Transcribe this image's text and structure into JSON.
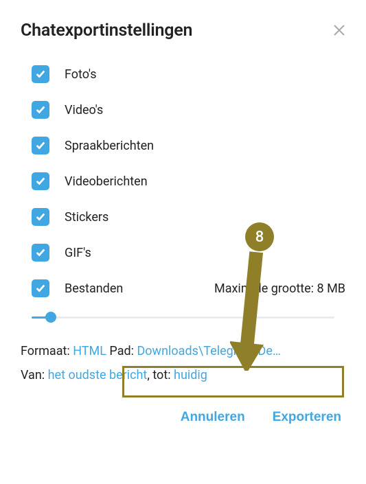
{
  "title": "Chatexportinstellingen",
  "options": {
    "photos": "Foto's",
    "videos": "Video's",
    "voice": "Spraakberichten",
    "videomsg": "Videoberichten",
    "stickers": "Stickers",
    "gifs": "GIF's",
    "files": "Bestanden"
  },
  "maxSizeLabel": "Maximale grootte: 8 MB",
  "formatLabel": "Formaat: ",
  "formatValue": "HTML",
  "pathLabel": " Pad: ",
  "pathValue": "Downloads\\Telegram De…",
  "fromLabel": "Van: ",
  "fromValue": "het oudste bericht",
  "toLabel": ", tot: ",
  "toValue": "huidig",
  "buttons": {
    "cancel": "Annuleren",
    "export": "Exporteren"
  },
  "annotation": {
    "number": "8"
  },
  "colors": {
    "accent": "#40a7e3",
    "highlight": "#8f7f29"
  }
}
